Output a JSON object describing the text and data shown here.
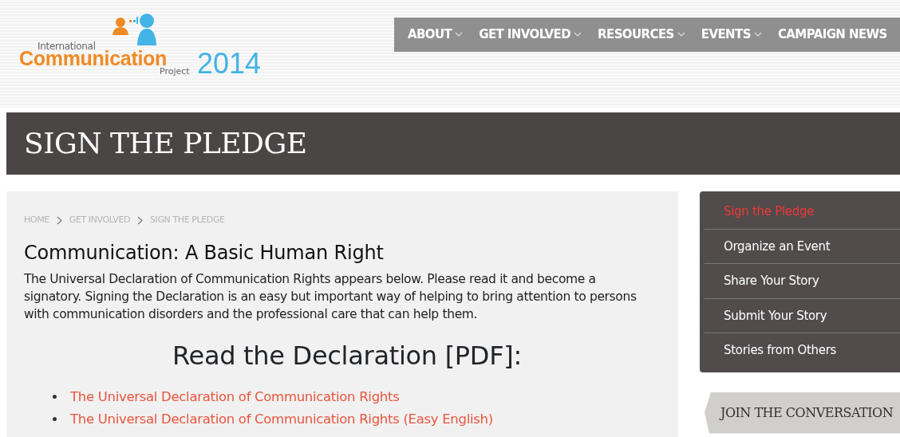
{
  "logo": {
    "line_1": "International",
    "line_2": "Communication",
    "line_3": "Project",
    "year": "2014"
  },
  "nav": [
    {
      "label": "ABOUT",
      "dropdown": true
    },
    {
      "label": "GET INVOLVED",
      "dropdown": true
    },
    {
      "label": "RESOURCES",
      "dropdown": true
    },
    {
      "label": "EVENTS",
      "dropdown": true
    },
    {
      "label": "CAMPAIGN NEWS",
      "dropdown": false
    }
  ],
  "page_title": "SIGN THE PLEDGE",
  "breadcrumb": [
    "HOME",
    "GET INVOLVED",
    "SIGN THE PLEDGE"
  ],
  "heading": "Communication: A Basic Human Right",
  "intro": "The Universal Declaration of Communication Rights appears below. Please read it and become a signatory. Signing the Declaration is an easy but important way of helping to bring attention to persons with communication disorders and the professional care that can help them.",
  "subheading": "Read the Declaration [PDF]:",
  "links": [
    "The Universal Declaration of Communication Rights",
    "The Universal Declaration of Communication Rights (Easy English)"
  ],
  "sidebar": {
    "items": [
      {
        "label": "Sign the Pledge",
        "selected": true
      },
      {
        "label": "Organize an Event",
        "selected": false
      },
      {
        "label": "Share Your Story",
        "selected": false
      },
      {
        "label": "Submit Your Story",
        "selected": false
      },
      {
        "label": "Stories from Others",
        "selected": false
      }
    ],
    "join_button": "JOIN THE CONVERSATION"
  }
}
